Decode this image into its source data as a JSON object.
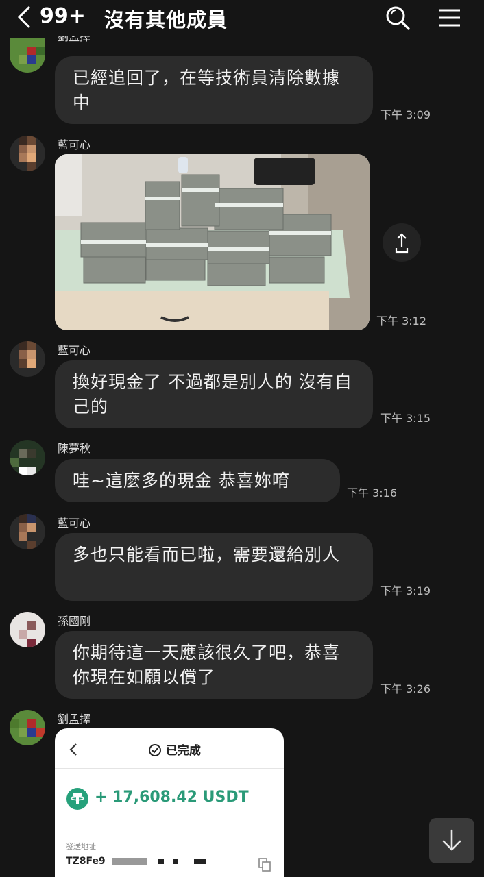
{
  "header": {
    "unread_count": "99+",
    "title": "沒有其他成員"
  },
  "messages": [
    {
      "sender": "劉孟擇",
      "text": "已經追回了，在等技術員清除數據中",
      "time": "下午 3:09"
    },
    {
      "sender": "藍可心",
      "type": "photo",
      "time": "下午 3:12"
    },
    {
      "sender": "藍可心",
      "text": "換好現金了 不過都是別人的 沒有自己的",
      "time": "下午 3:15"
    },
    {
      "sender": "陳夢秋",
      "text": "哇~這麼多的現金 恭喜妳唷",
      "time": "下午 3:16"
    },
    {
      "sender": "藍可心",
      "text": "多也只能看而已啦，需要還給別人",
      "time": "下午 3:19"
    },
    {
      "sender": "孫國剛",
      "text": "你期待這一天應該很久了吧，恭喜你現在如願以償了",
      "time": "下午 3:26"
    },
    {
      "sender": "劉孟擇",
      "type": "screenshot"
    }
  ],
  "receipt": {
    "status": "已完成",
    "amount": "+ 17,608.42 USDT",
    "label": "發送地址",
    "address": "TZ8Fe9"
  },
  "colors": {
    "background": "#151515",
    "bubble": "#2c2c2c",
    "tether_green": "#26a17b"
  },
  "icons": [
    "back-chevron-icon",
    "search-icon",
    "menu-icon",
    "share-icon",
    "scroll-down-icon",
    "check-circle-icon",
    "tether-icon",
    "copy-icon"
  ]
}
